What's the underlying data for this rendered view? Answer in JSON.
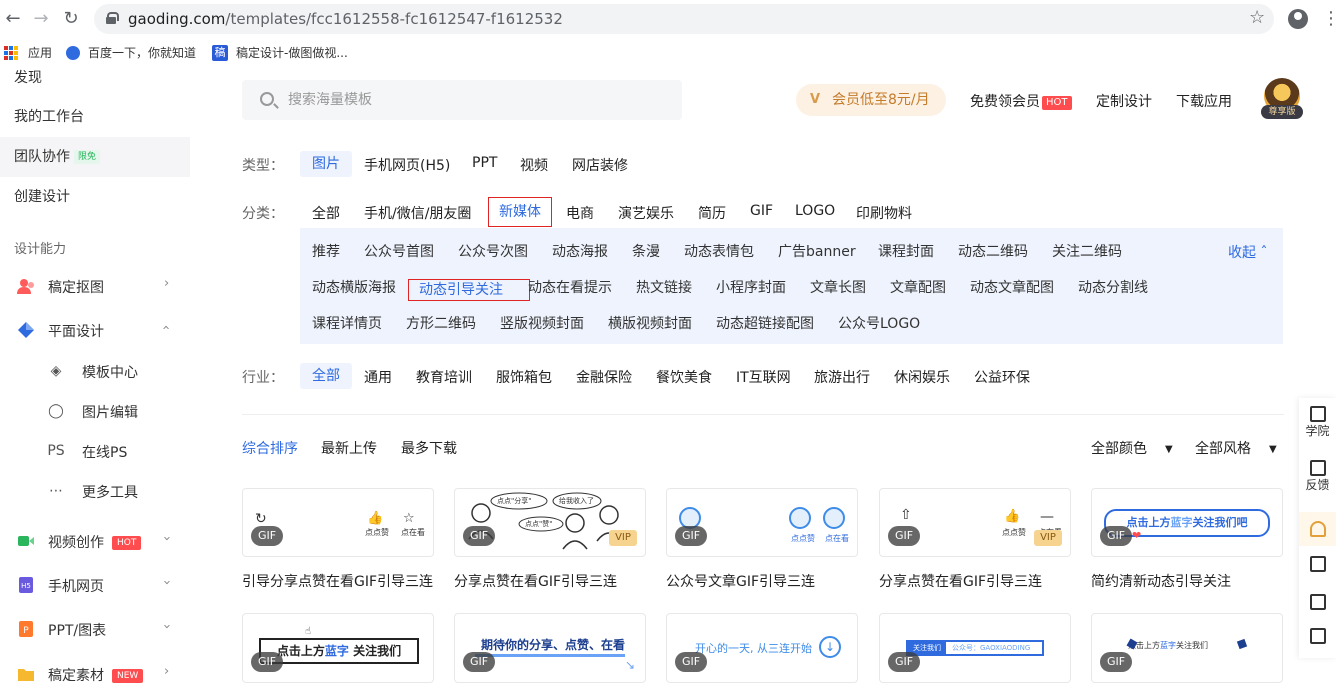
{
  "browser": {
    "url_host": "gaoding.com",
    "url_path": "/templates/fcc1612558-fc1612547-f1612532",
    "bookmarks": [
      "应用",
      "百度一下，你就知道",
      "稿定设计-做图做视..."
    ]
  },
  "sidebar": {
    "top_items": [
      "发现",
      "我的工作台",
      "团队协作",
      "创建设计"
    ],
    "team_tag": "限免",
    "section": "设计能力",
    "items": [
      {
        "label": "稿定抠图"
      },
      {
        "label": "平面设计"
      },
      {
        "label": "模板中心"
      },
      {
        "label": "图片编辑"
      },
      {
        "label": "在线PS",
        "prefix": "PS"
      },
      {
        "label": "更多工具"
      },
      {
        "label": "视频创作",
        "badge": "HOT"
      },
      {
        "label": "手机网页"
      },
      {
        "label": "PPT/图表"
      },
      {
        "label": "稿定素材",
        "badge": "NEW"
      }
    ]
  },
  "header": {
    "search_placeholder": "搜索海量模板",
    "vip_label": "会员低至8元/月",
    "free_vip": "免费领会员",
    "free_vip_badge": "HOT",
    "custom_design": "定制设计",
    "download_app": "下载应用",
    "avatar_badge": "尊享版"
  },
  "filters": {
    "type_label": "类型：",
    "types": [
      "图片",
      "手机网页(H5)",
      "PPT",
      "视频",
      "网店装修"
    ],
    "category_label": "分类：",
    "categories": [
      "全部",
      "手机/微信/朋友圈",
      "新媒体",
      "电商",
      "演艺娱乐",
      "简历",
      "GIF",
      "LOGO",
      "印刷物料"
    ],
    "sub_row1": [
      "推荐",
      "公众号首图",
      "公众号次图",
      "动态海报",
      "条漫",
      "动态表情包",
      "广告banner",
      "课程封面",
      "动态二维码",
      "关注二维码"
    ],
    "sub_row2": [
      "动态横版海报",
      "动态引导关注",
      "动态在看提示",
      "热文链接",
      "小程序封面",
      "文章长图",
      "文章配图",
      "动态文章配图",
      "动态分割线"
    ],
    "sub_row3": [
      "课程详情页",
      "方形二维码",
      "竖版视频封面",
      "横版视频封面",
      "动态超链接配图",
      "公众号LOGO"
    ],
    "collapse": "收起",
    "industry_label": "行业：",
    "industries": [
      "全部",
      "通用",
      "教育培训",
      "服饰箱包",
      "金融保险",
      "餐饮美食",
      "IT互联网",
      "旅游出行",
      "休闲娱乐",
      "公益环保"
    ]
  },
  "sort": {
    "options": [
      "综合排序",
      "最新上传",
      "最多下载"
    ],
    "color": "全部颜色",
    "style": "全部风格"
  },
  "cards": [
    {
      "title": "引导分享点赞在看GIF引导三连",
      "gif": "GIF"
    },
    {
      "title": "分享点赞在看GIF引导三连",
      "gif": "GIF",
      "vip": "VIP"
    },
    {
      "title": "公众号文章GIF引导三连",
      "gif": "GIF"
    },
    {
      "title": "分享点赞在看GIF引导三连",
      "gif": "GIF",
      "vip": "VIP"
    },
    {
      "title": "简约清新动态引导关注",
      "gif": "GIF"
    }
  ],
  "card_text": {
    "like": "点点赞",
    "look": "点在看",
    "follow_blue_pre": "点击上方",
    "follow_blue_hl": "蓝字",
    "follow_blue_post": "关注我们吧",
    "b1_pre": "点击上方",
    "b1_hl": "蓝字",
    "b1_post": "关注我们",
    "b2": "期待你的分享、点赞、在看",
    "b3": "开心的一天, 从三连开始",
    "b4_left": "关注我们",
    "b4_right": "公众号：GAOXIAODING",
    "b5_pre": "点击上方",
    "b5_hl": "蓝字",
    "b5_post": "关注我们",
    "bubble1": "点点\"分享\"",
    "bubble2": "给我收入了",
    "bubble3": "点点\"赞\""
  },
  "rightbar": [
    "学院",
    "反馈"
  ],
  "colors": {
    "accent": "#2f6bdf",
    "hot": "#ff4d4f",
    "highlight_box": "#e02424"
  }
}
